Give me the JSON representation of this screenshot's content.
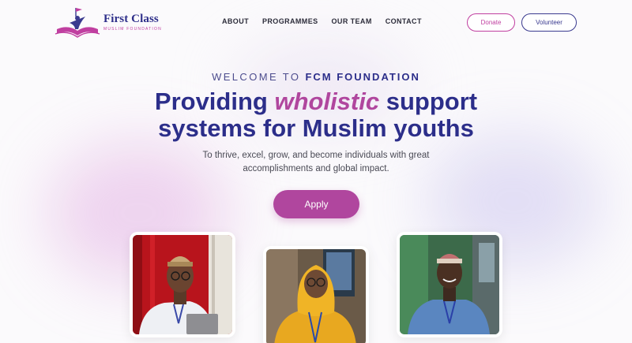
{
  "brand": {
    "title": "First Class",
    "subtitle": "MUSLIM FOUNDATION"
  },
  "nav": {
    "items": [
      "ABOUT",
      "PROGRAMMES",
      "OUR TEAM",
      "CONTACT"
    ]
  },
  "header_buttons": {
    "donate": "Donate",
    "volunteer": "Volunteer"
  },
  "hero": {
    "eyebrow_prefix": "WELCOME TO",
    "eyebrow_strong": "FCM FOUNDATION",
    "headline_before": "Providing",
    "headline_accent": "wholistic",
    "headline_after": "support",
    "headline_line2": "systems for Muslim youths",
    "subtitle_line1": "To thrive, excel, grow, and become individuals with great",
    "subtitle_line2": "accomplishments and global impact.",
    "cta": "Apply"
  },
  "colors": {
    "brand_navy": "#2c2e8a",
    "brand_magenta": "#b0469e",
    "background": "#fbfafc"
  },
  "icons": [
    "book-logo-icon"
  ]
}
